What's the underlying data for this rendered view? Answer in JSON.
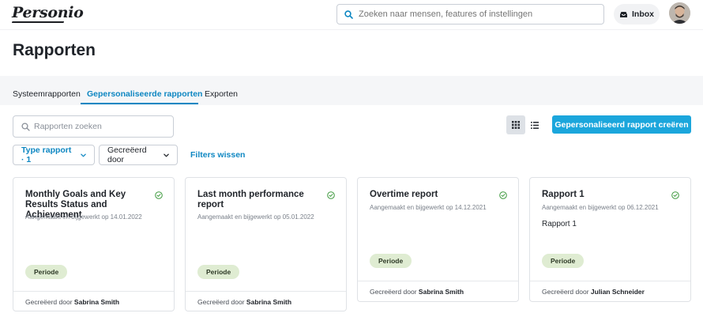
{
  "app": {
    "logo_text": "Personio"
  },
  "header": {
    "search_placeholder": "Zoeken naar mensen, features of instellingen",
    "inbox_label": "Inbox"
  },
  "page": {
    "title": "Rapporten"
  },
  "tabs": [
    {
      "label": "Systeemrapporten",
      "active": false
    },
    {
      "label": "Gepersonaliseerde rapporten",
      "active": true
    },
    {
      "label": "Exporten",
      "active": false
    }
  ],
  "toolbar": {
    "search_placeholder": "Rapporten zoeken",
    "create_label": "Gepersonaliseerd rapport creëren",
    "view_mode": "grid"
  },
  "filters": {
    "type_label": "Type rapport · 1",
    "created_by_label": "Gecreëerd door",
    "clear_label": "Filters wissen"
  },
  "cards": [
    {
      "title": "Monthly Goals and Key Results Status and Achievement",
      "meta": "Aangemaakt en bijgewerkt op 14.01.2022",
      "description": "",
      "badge": "Periode",
      "created_by_prefix": "Gecreëerd door",
      "created_by_name": "Sabrina Smith"
    },
    {
      "title": "Last month performance report",
      "meta": "Aangemaakt en bijgewerkt op 05.01.2022",
      "description": "",
      "badge": "Periode",
      "created_by_prefix": "Gecreëerd door",
      "created_by_name": "Sabrina Smith"
    },
    {
      "title": "Overtime report",
      "meta": "Aangemaakt en bijgewerkt op 14.12.2021",
      "description": "",
      "badge": "Periode",
      "created_by_prefix": "Gecreëerd door",
      "created_by_name": "Sabrina Smith"
    },
    {
      "title": "Rapport 1",
      "meta": "Aangemaakt en bijgewerkt op 06.12.2021",
      "description": "Rapport 1",
      "badge": "Periode",
      "created_by_prefix": "Gecreëerd door",
      "created_by_name": "Julian Schneider"
    }
  ],
  "colors": {
    "accent": "#0e87c2",
    "primary_button": "#1ba6dc",
    "badge_bg": "#dfecd2",
    "check_green": "#3f9a3f"
  }
}
